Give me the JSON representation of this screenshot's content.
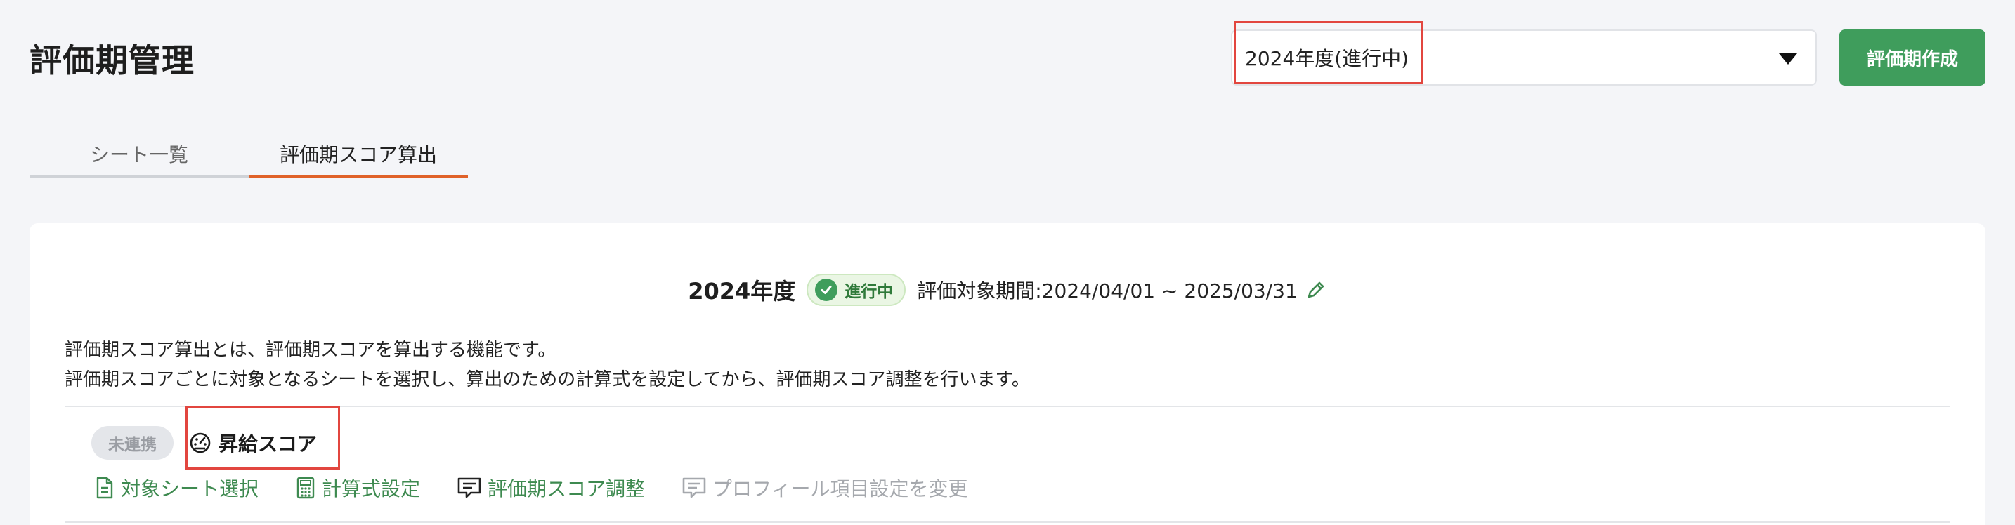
{
  "header": {
    "title": "評価期管理",
    "period_select_value": "2024年度(進行中)",
    "create_button_label": "評価期作成"
  },
  "tabs": [
    {
      "label": "シート一覧",
      "active": false
    },
    {
      "label": "評価期スコア算出",
      "active": true
    }
  ],
  "card": {
    "year": "2024年度",
    "status": "進行中",
    "period": "評価対象期間:2024/04/01 ~ 2025/03/31",
    "description": [
      "評価期スコア算出とは、評価期スコアを算出する機能です。",
      "評価期スコアごとに対象となるシートを選択し、算出のための計算式を設定してから、評価期スコア調整を行います。"
    ],
    "score": {
      "badge": "未連携",
      "title": "昇給スコア",
      "actions": [
        {
          "label": "対象シート選択",
          "icon": "document-icon",
          "enabled": true
        },
        {
          "label": "計算式設定",
          "icon": "calculator-icon",
          "enabled": true
        },
        {
          "label": "評価期スコア調整",
          "icon": "comment-icon",
          "enabled": true
        },
        {
          "label": "プロフィール項目設定を変更",
          "icon": "comment-icon",
          "enabled": false
        }
      ]
    }
  },
  "colors": {
    "accent_green": "#3f9d5c",
    "tab_active": "#e0622a",
    "highlight": "#e2463f"
  }
}
